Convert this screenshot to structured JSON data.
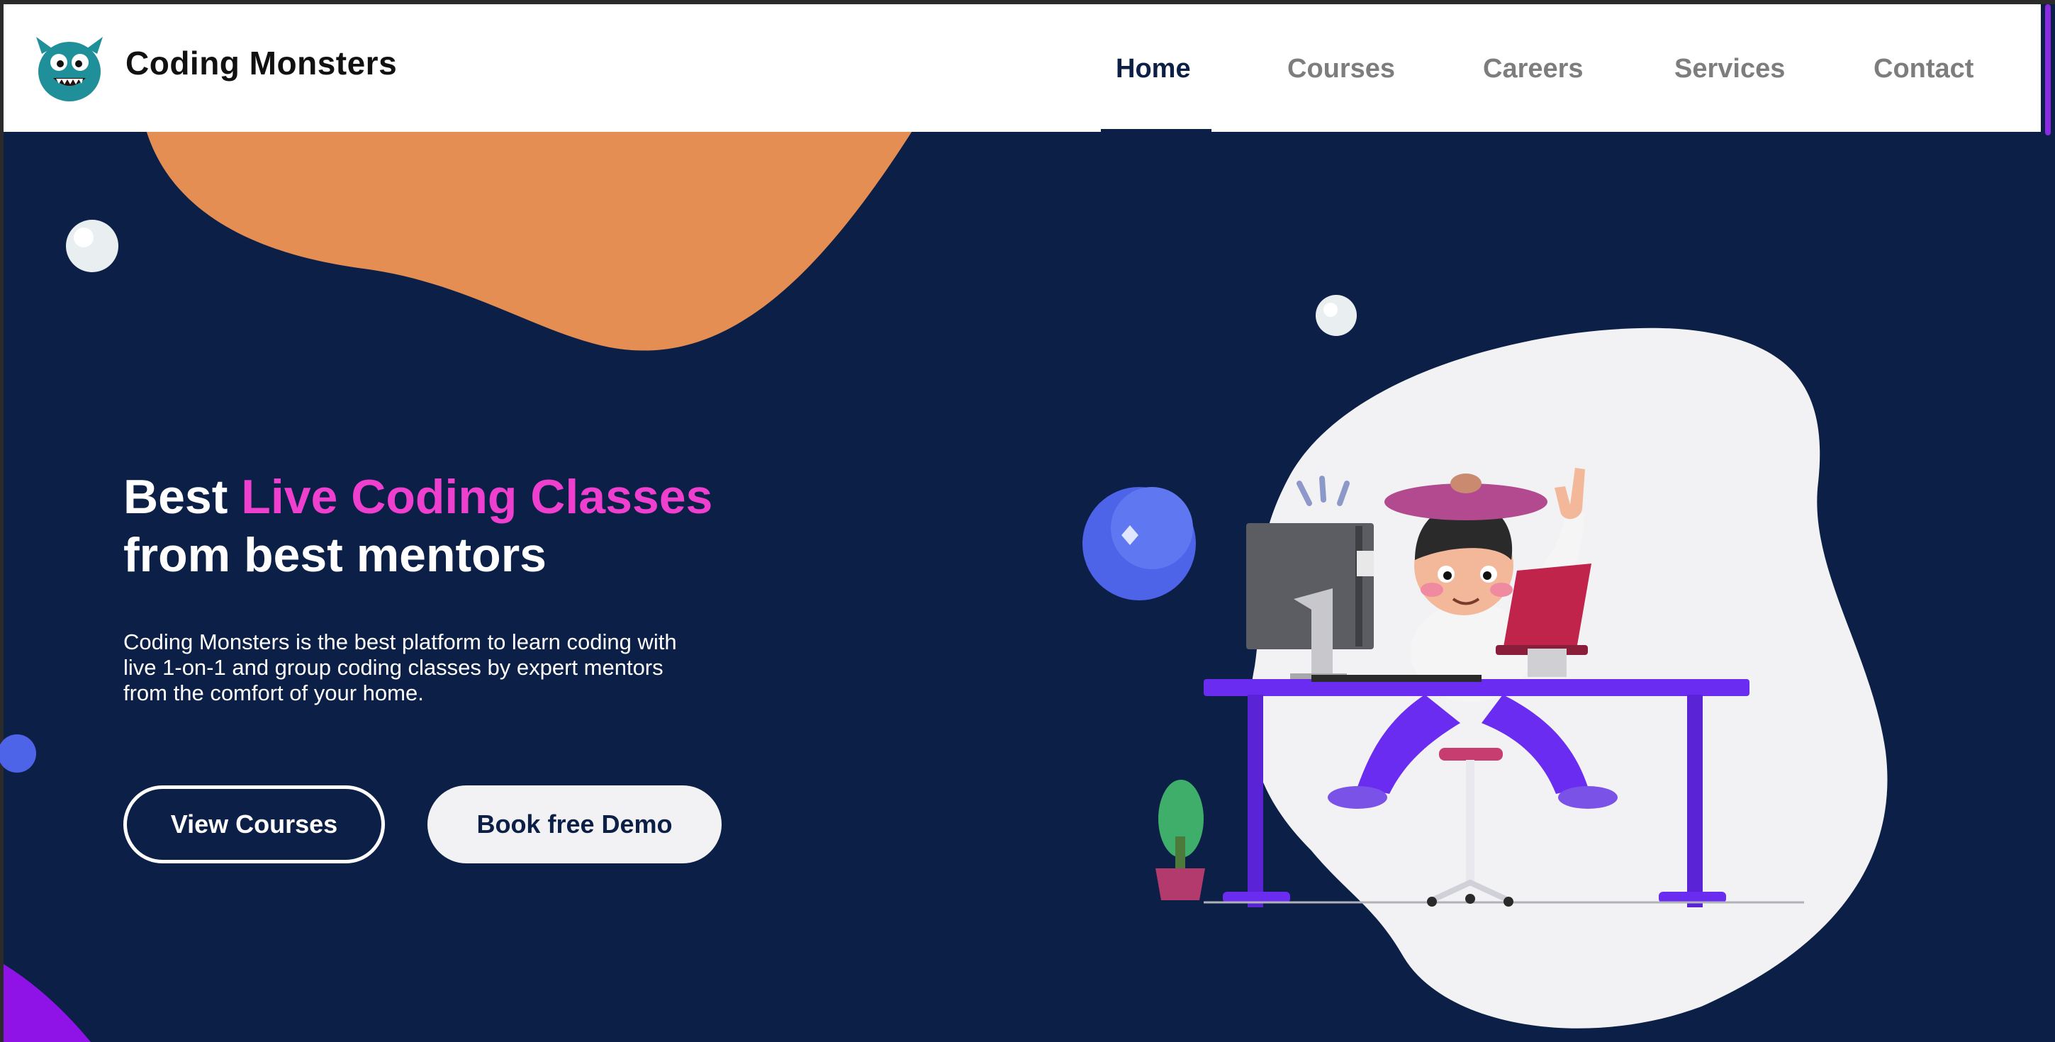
{
  "brand": {
    "name": "Coding Monsters",
    "logo_icon": "monster-logo-icon"
  },
  "nav": {
    "items": [
      {
        "label": "Home",
        "active": true
      },
      {
        "label": "Courses",
        "active": false
      },
      {
        "label": "Careers",
        "active": false
      },
      {
        "label": "Services",
        "active": false
      },
      {
        "label": "Contact",
        "active": false
      }
    ]
  },
  "hero": {
    "title_prefix": "Best ",
    "title_accent": "Live Coding Classes",
    "title_line2": "from best mentors",
    "description": "Coding Monsters is the best platform to learn coding with live 1-on-1 and group coding classes by expert mentors from the comfort of your home.",
    "primary_button": "View Courses",
    "secondary_button": "Book free Demo"
  },
  "colors": {
    "background": "#0b1f47",
    "accent_pink": "#ee3fcf",
    "blob_orange": "#e58e54",
    "desk_purple": "#6a2cf0",
    "scroll_thumb": "#8a2be2"
  }
}
